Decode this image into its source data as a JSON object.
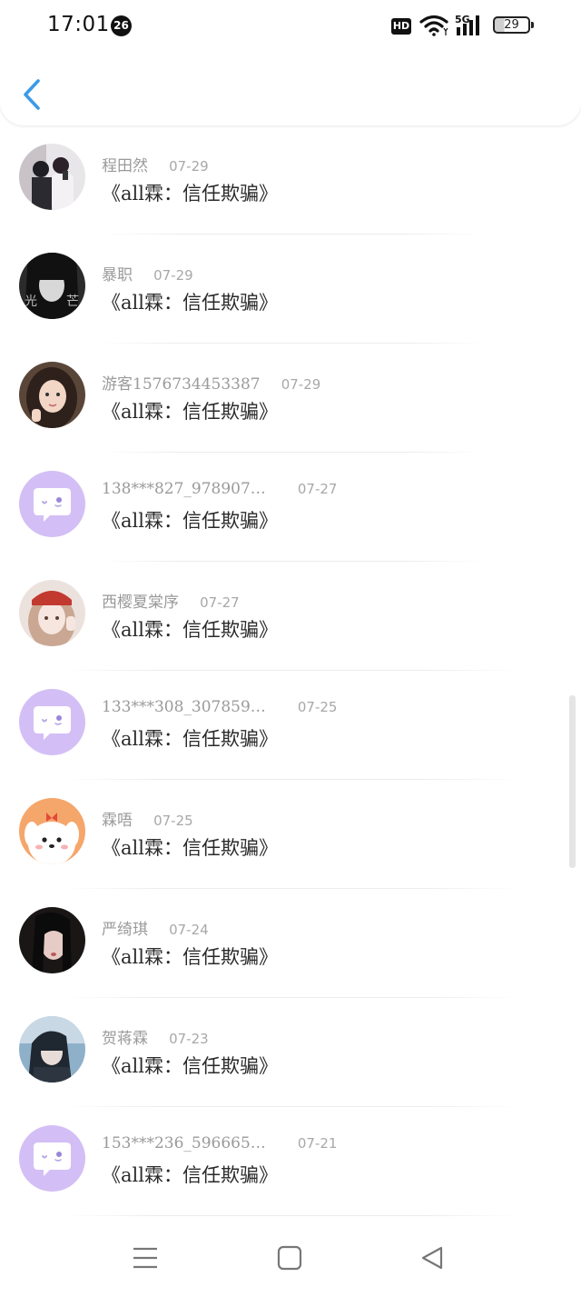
{
  "status_bar": {
    "time": "17:01",
    "notification_count": "26",
    "hd_label": "HD",
    "network": "5G",
    "battery": "29"
  },
  "header": {
    "back_icon": "chevron-left-icon",
    "accent_color": "#3a9be8"
  },
  "items": [
    {
      "username": "程田然",
      "date": "07-29",
      "title": "《all霖：信任欺骗》",
      "avatar": "photo"
    },
    {
      "username": "暴职",
      "date": "07-29",
      "title": "《all霖：信任欺骗》",
      "avatar": "photo"
    },
    {
      "username": "游客1576734453387",
      "date": "07-29",
      "title": "《all霖：信任欺骗》",
      "avatar": "photo"
    },
    {
      "username": "138***827_978907…",
      "date": "07-27",
      "title": "《all霖：信任欺骗》",
      "avatar": "default-chat-bubble"
    },
    {
      "username": "西樱夏棠序",
      "date": "07-27",
      "title": "《all霖：信任欺骗》",
      "avatar": "photo"
    },
    {
      "username": "133***308_307859…",
      "date": "07-25",
      "title": "《all霖：信任欺骗》",
      "avatar": "default-chat-bubble"
    },
    {
      "username": "霖唔",
      "date": "07-25",
      "title": "《all霖：信任欺骗》",
      "avatar": "cartoon-dog"
    },
    {
      "username": "严绮琪",
      "date": "07-24",
      "title": "《all霖：信任欺骗》",
      "avatar": "photo"
    },
    {
      "username": "贺蒋霖",
      "date": "07-23",
      "title": "《all霖：信任欺骗》",
      "avatar": "photo"
    },
    {
      "username": "153***236_596665…",
      "date": "07-21",
      "title": "《all霖：信任欺骗》",
      "avatar": "default-chat-bubble"
    }
  ],
  "colors": {
    "default_avatar_bg": "#d3bff5",
    "username": "#9a9a9a",
    "title": "#2a2a2a"
  },
  "nav_bar": {
    "icons": [
      "menu-icon",
      "home-square-icon",
      "back-triangle-icon"
    ]
  }
}
